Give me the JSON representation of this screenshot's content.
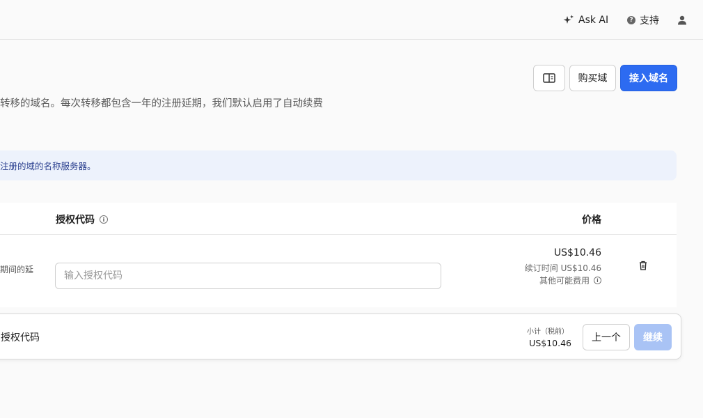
{
  "header": {
    "ask_ai": "Ask AI",
    "support": "支持"
  },
  "actions": {
    "buy_label": "购买域",
    "primary_label": "接入域名"
  },
  "description": "转移的域名。每次转移都包含一年的注册延期，我们默认启用了自动续费",
  "banner": "注册的域的名称服务器。",
  "table": {
    "col_auth": "授权代码",
    "col_price": "价格",
    "row": {
      "left_text": "期间的延",
      "auth_placeholder": "输入授权代码",
      "price": "US$10.46",
      "renewal": "续订时间 US$10.46",
      "other_fees": "其他可能费用"
    }
  },
  "footer": {
    "left_text": "授权代码",
    "subtotal_label": "小计（税前）",
    "subtotal_value": "US$10.46",
    "prev_label": "上一个",
    "next_label": "继续"
  },
  "colors": {
    "primary": "#2d6bf1",
    "banner_bg": "#edf2fc",
    "disabled": "#a9c3f5"
  }
}
